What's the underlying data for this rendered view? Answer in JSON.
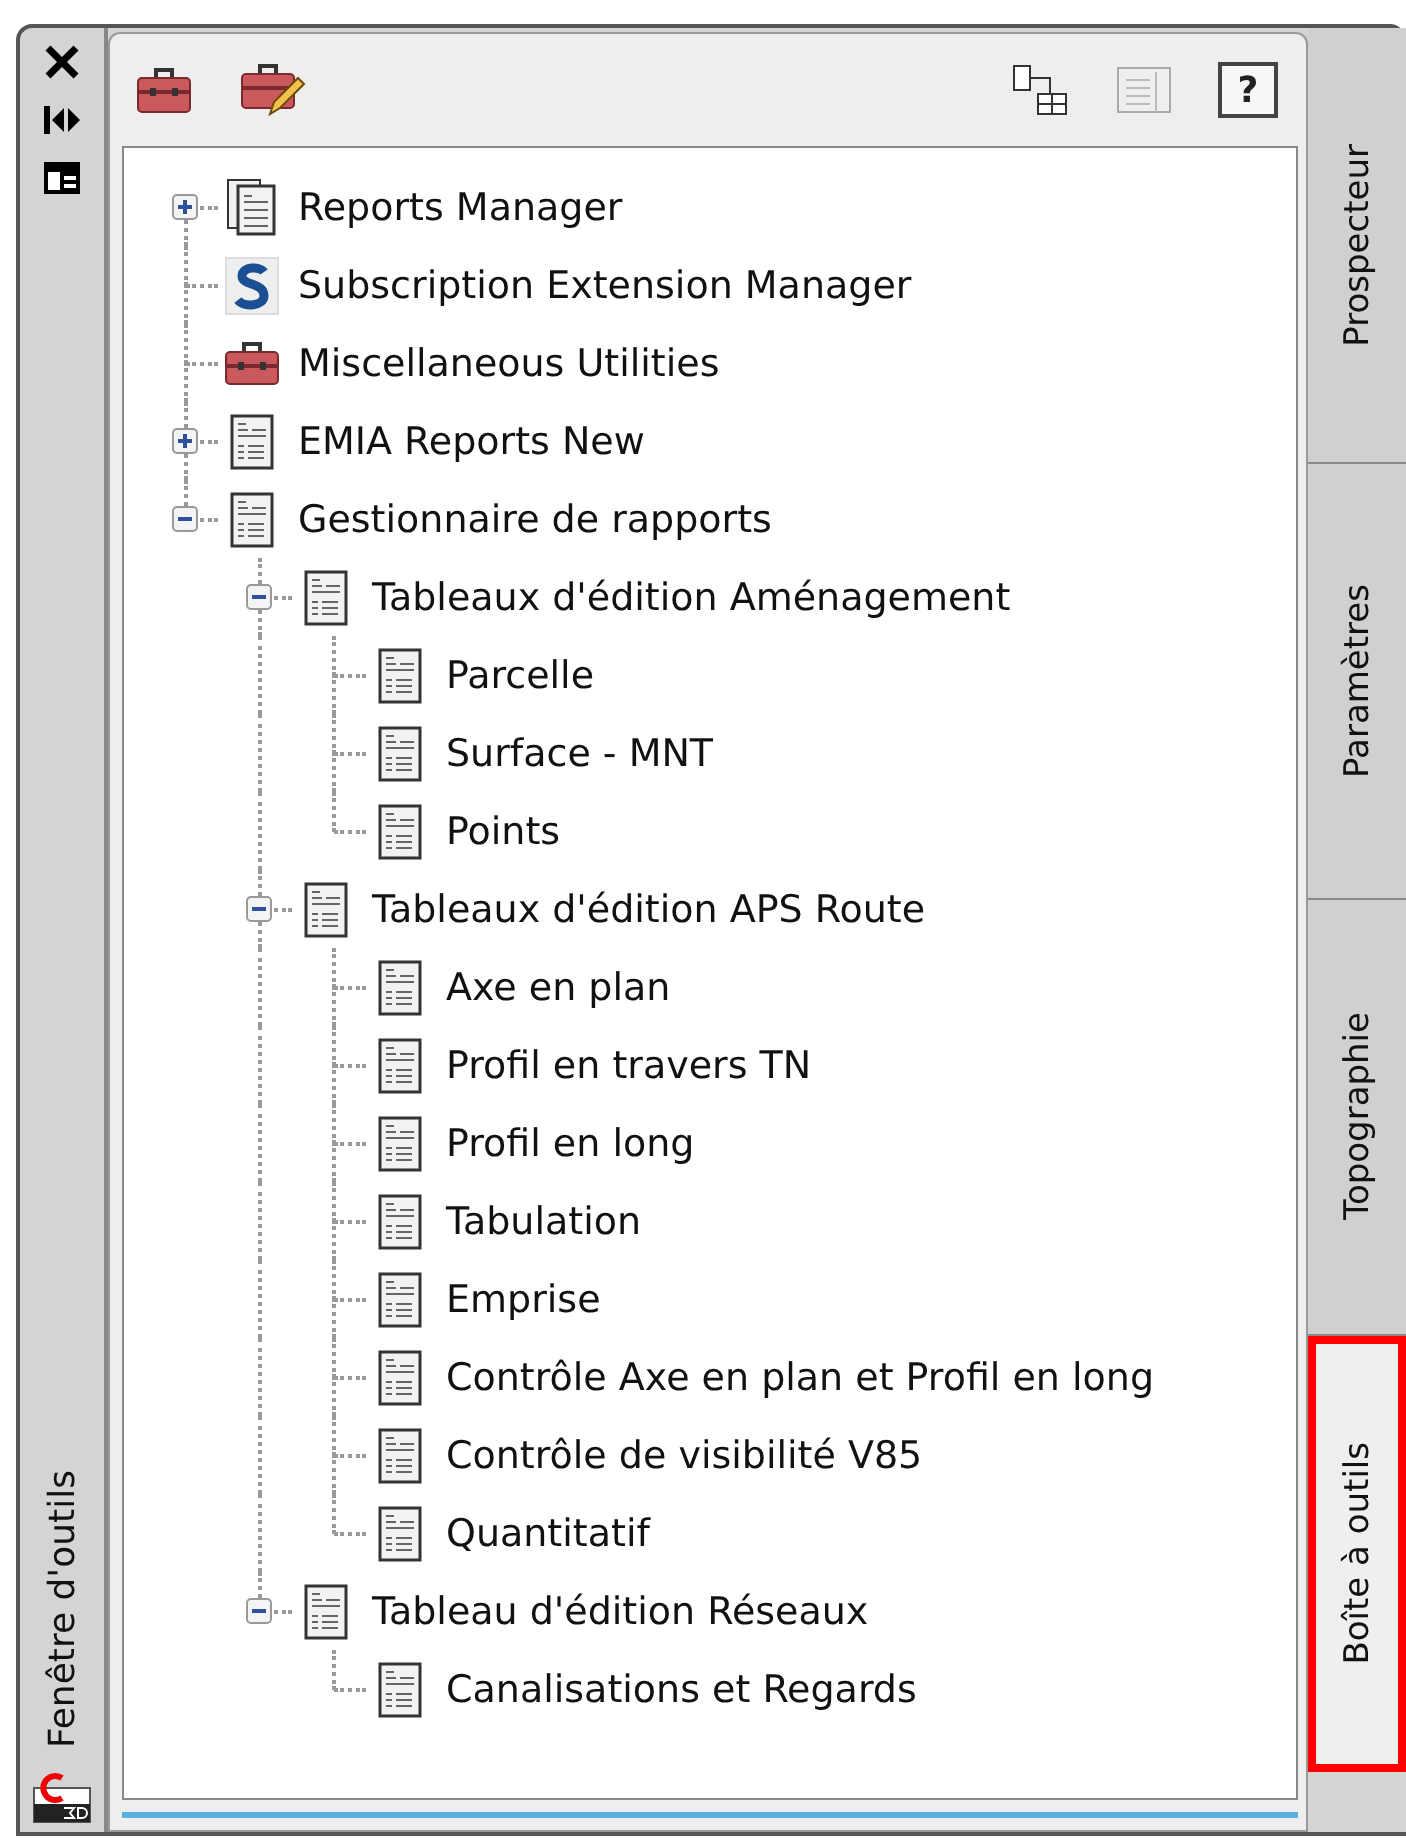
{
  "window": {
    "title": "Fenêtre d'outils"
  },
  "toolbar": {
    "help_label": "?"
  },
  "tree": [
    {
      "label": "Reports Manager",
      "kind": "manager",
      "expanded": false
    },
    {
      "label": "Subscription Extension Manager",
      "kind": "extension"
    },
    {
      "label": "Miscellaneous Utilities",
      "kind": "utilities"
    },
    {
      "label": "EMIA Reports New",
      "kind": "report",
      "expanded": false
    },
    {
      "label": "Gestionnaire de rapports",
      "kind": "report",
      "expanded": true,
      "children": [
        {
          "label": "Tableaux d'édition Aménagement",
          "kind": "report",
          "expanded": true,
          "children": [
            {
              "label": "Parcelle",
              "kind": "report"
            },
            {
              "label": "Surface - MNT",
              "kind": "report"
            },
            {
              "label": "Points",
              "kind": "report"
            }
          ]
        },
        {
          "label": "Tableaux d'édition APS Route",
          "kind": "report",
          "expanded": true,
          "children": [
            {
              "label": "Axe en plan",
              "kind": "report"
            },
            {
              "label": "Profil en travers TN",
              "kind": "report"
            },
            {
              "label": "Profil en long",
              "kind": "report"
            },
            {
              "label": "Tabulation",
              "kind": "report"
            },
            {
              "label": "Emprise",
              "kind": "report"
            },
            {
              "label": "Contrôle Axe en plan et Profil en long",
              "kind": "report"
            },
            {
              "label": "Contrôle de visibilité V85",
              "kind": "report"
            },
            {
              "label": "Quantitatif",
              "kind": "report"
            }
          ]
        },
        {
          "label": "Tableau d'édition Réseaux",
          "kind": "report",
          "expanded": true,
          "children": [
            {
              "label": "Canalisations et Regards",
              "kind": "report"
            }
          ]
        }
      ]
    }
  ],
  "tabs": [
    {
      "label": "Prospecteur",
      "selected": false
    },
    {
      "label": "Paramètres",
      "selected": false
    },
    {
      "label": "Topographie",
      "selected": false
    },
    {
      "label": "Boîte à outils",
      "selected": true
    }
  ]
}
